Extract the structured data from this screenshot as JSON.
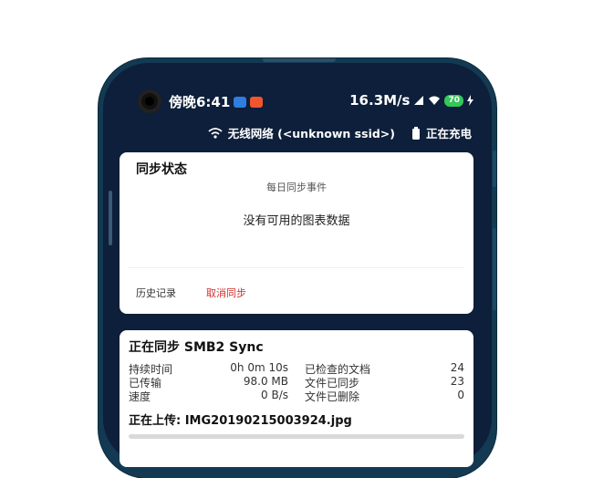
{
  "status_bar": {
    "time": "傍晚6:41",
    "net_speed": "16.3M/s",
    "battery_level": "70",
    "app_icon_colors": [
      "#2f7de1",
      "#f0552d"
    ]
  },
  "connection": {
    "wifi_text": "无线网络 (<unknown ssid>)",
    "charging_text": "正在充电"
  },
  "sync_status": {
    "title": "同步状态",
    "chart_subtitle": "每日同步事件",
    "empty_text": "没有可用的图表数据",
    "history_button": "历史记录",
    "cancel_button": "取消同步",
    "cancel_color": "#d32f2f"
  },
  "syncing": {
    "title": "正在同步 SMB2 Sync",
    "left_stats": [
      {
        "label": "持续时间",
        "value": "0h 0m 10s"
      },
      {
        "label": "已传输",
        "value": "98.0 MB"
      },
      {
        "label": "速度",
        "value": "0 B/s"
      }
    ],
    "right_stats": [
      {
        "label": "已检查的文档",
        "value": "24"
      },
      {
        "label": "文件已同步",
        "value": "23"
      },
      {
        "label": "文件已删除",
        "value": "0"
      }
    ],
    "upload_text": "正在上传: IMG20190215003924.jpg",
    "progress_fraction": 0
  }
}
